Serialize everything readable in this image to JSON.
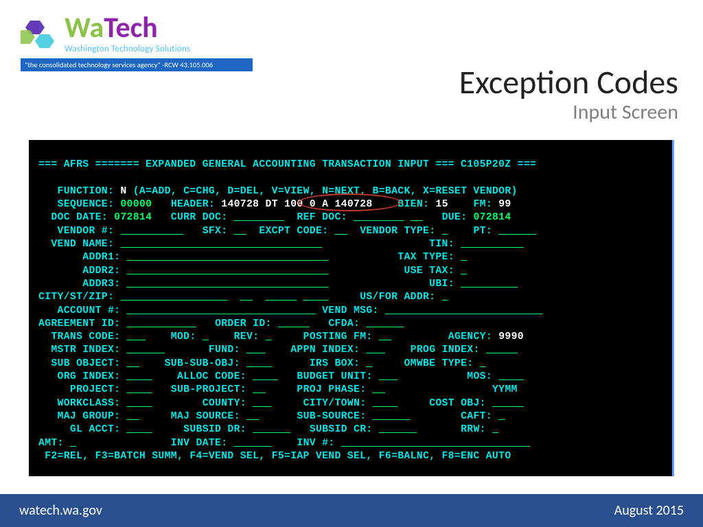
{
  "logo": {
    "wa": "Wa",
    "tech": "Tech",
    "subtitle": "Washington Technology Solutions",
    "banner": "\"the consolidated technology services agency\" -RCW 43.105.006"
  },
  "title": {
    "main": "Exception Codes",
    "sub": "Input Screen"
  },
  "terminal": {
    "header": "=== AFRS ======= EXPANDED GENERAL ACCOUNTING TRANSACTION INPUT === C105P20Z ===",
    "function_label": "FUNCTION:",
    "function_val": "N",
    "function_opts": "(A=ADD, C=CHG, D=DEL, V=VIEW, N=NEXT, B=BACK, X=RESET VENDOR)",
    "sequence_label": "SEQUENCE:",
    "sequence_val": "00000",
    "header_label": "HEADER:",
    "header_val": "140728 DT 100 0 A 140728",
    "bien_label": "BIEN:",
    "bien_val": "15",
    "fm_label": "FM:",
    "fm_val": "99",
    "docdate_label": "DOC DATE:",
    "docdate_val": "072814",
    "currdoc_label": "CURR DOC:",
    "refdoc_label": "REF DOC:",
    "due_label": "DUE:",
    "due_val": "072814",
    "vendor_label": "VENDOR #:",
    "sfx_label": "SFX:",
    "excpt_label": "EXCPT CODE:",
    "vendortype_label": "VENDOR TYPE:",
    "pt_label": "PT:",
    "vendname_label": "VEND NAME:",
    "tin_label": "TIN:",
    "addr1_label": "ADDR1:",
    "taxtype_label": "TAX TYPE:",
    "addr2_label": "ADDR2:",
    "usetax_label": "USE TAX:",
    "addr3_label": "ADDR3:",
    "ubi_label": "UBI:",
    "citystzip_label": "CITY/ST/ZIP:",
    "usfor_label": "US/FOR ADDR:",
    "account_label": "ACCOUNT #:",
    "vendmsg_label": "VEND MSG:",
    "agreement_label": "AGREEMENT ID:",
    "orderid_label": "ORDER ID:",
    "cfda_label": "CFDA:",
    "transcode_label": "TRANS CODE:",
    "mod_label": "MOD:",
    "rev_label": "REV:",
    "postingfm_label": "POSTING FM:",
    "agency_label": "AGENCY:",
    "agency_val": "9990",
    "mstrindex_label": "MSTR INDEX:",
    "fund_label": "FUND:",
    "appnindex_label": "APPN INDEX:",
    "progindex_label": "PROG INDEX:",
    "subobject_label": "SUB OBJECT:",
    "subsubobj_label": "SUB-SUB-OBJ:",
    "irsbox_label": "IRS BOX:",
    "omwbe_label": "OMWBE TYPE:",
    "orgindex_label": "ORG INDEX:",
    "alloccode_label": "ALLOC CODE:",
    "budgetunit_label": "BUDGET UNIT:",
    "mos_label": "MOS:",
    "project_label": "PROJECT:",
    "subproject_label": "SUB-PROJECT:",
    "projphase_label": "PROJ PHASE:",
    "yymm_label": "YYMM",
    "workclass_label": "WORKCLASS:",
    "county_label": "COUNTY:",
    "citytown_label": "CITY/TOWN:",
    "costobj_label": "COST OBJ:",
    "majgroup_label": "MAJ GROUP:",
    "majsource_label": "MAJ SOURCE:",
    "subsource_label": "SUB-SOURCE:",
    "caft_label": "CAFT:",
    "glacct_label": "GL ACCT:",
    "subsiddr_label": "SUBSID DR:",
    "subsidcr_label": "SUBSID CR:",
    "rrw_label": "RRW:",
    "amt_label": "AMT:",
    "invdate_label": "INV DATE:",
    "invnum_label": "INV #:",
    "fkeys": "F2=REL, F3=BATCH SUMM, F4=VEND SEL, F5=IAP VEND SEL, F6=BALNC, F8=ENC AUTO"
  },
  "footer": {
    "left": "watech.wa.gov",
    "right": "August 2015"
  }
}
